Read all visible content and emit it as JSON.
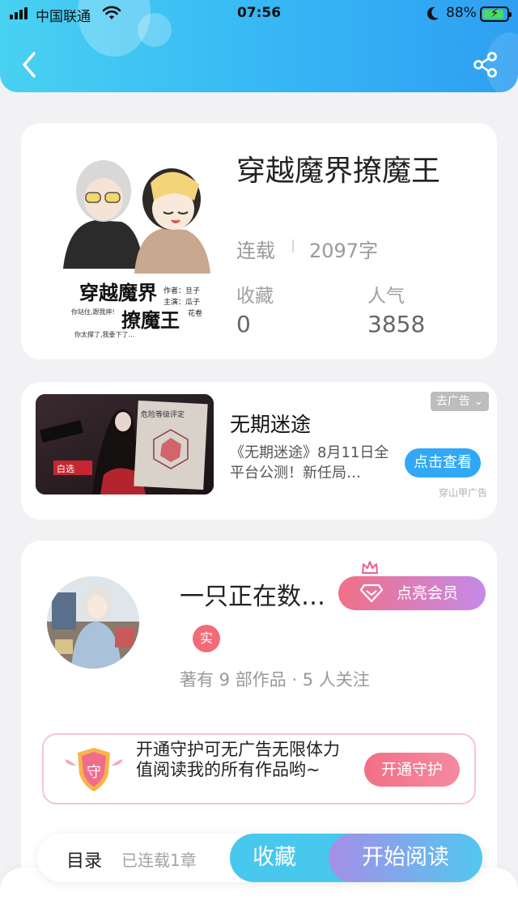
{
  "status_bar": {
    "carrier": "中国联通",
    "time": "07:56",
    "battery": "88%",
    "battery_level": 0.88
  },
  "header": {
    "back_icon": "chevron-left-icon",
    "share_icon": "share-icon"
  },
  "book": {
    "title": "穿越魔界撩魔王",
    "status": "连载",
    "word_count": "2097字",
    "favorites_label": "收藏",
    "favorites_value": "0",
    "popularity_label": "人气",
    "popularity_value": "3858",
    "cover": {
      "title_line1": "穿越魔界",
      "title_line2": "撩魔王",
      "credit1": "作者：旦子",
      "credit2": "主演：瓜子",
      "credit3": "花卷",
      "caption1": "你站住,跟我摔!",
      "caption2": "你太撑了,我委下了…"
    }
  },
  "ad": {
    "title": "无期迷途",
    "description": "《无期迷途》8月11日全平台公测！新任局…",
    "remove_label": "去广告",
    "button_label": "点击查看",
    "source": "穿山甲广告",
    "image_text_badge": "白选",
    "image_text_sign": "危险等级评定"
  },
  "author": {
    "name": "一只正在数…",
    "vip_label": "点亮会员",
    "verified_badge": "实",
    "stats": "著有 9 部作品 · 5 人关注"
  },
  "guard": {
    "icon_text": "守",
    "text": "开通守护可无广告无限体力值阅读我的所有作品哟~",
    "button_label": "开通守护"
  },
  "bottom_nav": {
    "toc_label": "目录",
    "chapters": "已连载1章",
    "favorite_button": "收藏",
    "read_button": "开始阅读"
  },
  "colors": {
    "header_gradient": [
      "#49d1f2",
      "#2e9ff2"
    ],
    "vip_gradient": [
      "#f07088",
      "#c58ae8"
    ],
    "guard_button": "#f26f86",
    "favorite_button": "#48c8ec",
    "ad_button": "#31a8f6"
  }
}
